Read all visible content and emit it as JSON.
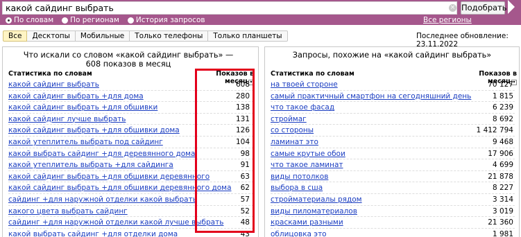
{
  "search": {
    "value": "какой сайдинг выбрать",
    "clear_icon": "×",
    "button": "Подобрать"
  },
  "modes": [
    {
      "label": "По словам",
      "checked": true
    },
    {
      "label": "По регионам",
      "checked": false
    },
    {
      "label": "История запросов",
      "checked": false
    }
  ],
  "all_regions": "Все регионы",
  "tabs": [
    "Все",
    "Десктопы",
    "Мобильные",
    "Только телефоны",
    "Только планшеты"
  ],
  "updated": "Последнее обновление: 23.11.2022",
  "left": {
    "title": "Что искали со словом «какой сайдинг выбрать» — 608 показов в месяц",
    "col_keyword": "Статистика по словам",
    "col_count": "Показов в месяц",
    "rows": [
      {
        "kw": "какой сайдинг выбрать",
        "count": "608"
      },
      {
        "kw": "какой сайдинг выбрать +для дома",
        "count": "280"
      },
      {
        "kw": "какой сайдинг выбрать +для обшивки",
        "count": "138"
      },
      {
        "kw": "какой сайдинг лучше выбрать",
        "count": "131"
      },
      {
        "kw": "какой сайдинг выбрать +для обшивки дома",
        "count": "126"
      },
      {
        "kw": "какой утеплитель выбрать под сайдинг",
        "count": "104"
      },
      {
        "kw": "какой выбрать сайдинг +для деревянного дома",
        "count": "98"
      },
      {
        "kw": "какой утеплитель выбрать +для сайдинга",
        "count": "91"
      },
      {
        "kw": "какой сайдинг выбрать +для обшивки деревянного",
        "count": "63"
      },
      {
        "kw": "какой сайдинг выбрать +для обшивки деревянного дома",
        "count": "62"
      },
      {
        "kw": "сайдинг +для наружной отделки какой выбрать",
        "count": "57"
      },
      {
        "kw": "какого цвета выбрать сайдинг",
        "count": "52"
      },
      {
        "kw": "сайдинг +для наружной отделки какой лучше выбрать",
        "count": "48"
      },
      {
        "kw": "какой выбрать сайдинг +для отделки дома",
        "count": "43"
      }
    ]
  },
  "right": {
    "title": "Запросы, похожие на «какой сайдинг выбрать»",
    "col_keyword": "Статистика по словам",
    "col_count": "Показов в месяц",
    "rows": [
      {
        "kw": "на твоей стороне",
        "count": "70 127"
      },
      {
        "kw": "самый практичный смартфон на сегодняшний день",
        "count": "1 815"
      },
      {
        "kw": "что такое фасад",
        "count": "6 239"
      },
      {
        "kw": "строймаг",
        "count": "8 692"
      },
      {
        "kw": "со стороны",
        "count": "1 412 794"
      },
      {
        "kw": "ламинат это",
        "count": "9 468"
      },
      {
        "kw": "самые крутые обои",
        "count": "17 906"
      },
      {
        "kw": "что такое ламинат",
        "count": "4 699"
      },
      {
        "kw": "виды потолков",
        "count": "21 878"
      },
      {
        "kw": "выбора в сша",
        "count": "8 227"
      },
      {
        "kw": "стройматериалы рядом",
        "count": "3 314"
      },
      {
        "kw": "виды пиломатериалов",
        "count": "3 019"
      },
      {
        "kw": "красками разными",
        "count": "21 360"
      },
      {
        "kw": "облицовка это",
        "count": "1 981"
      }
    ]
  }
}
